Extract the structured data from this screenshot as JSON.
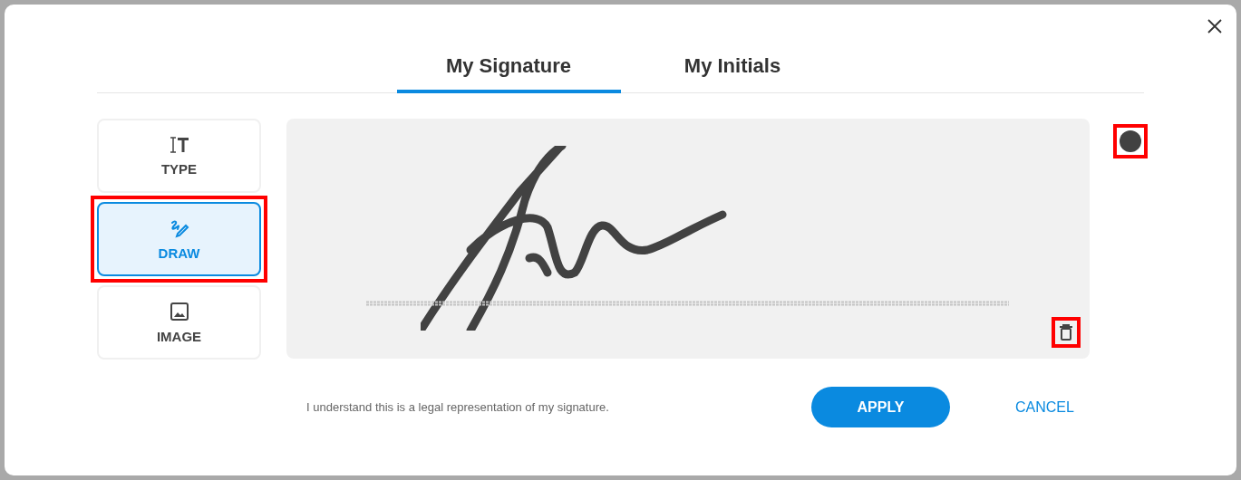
{
  "tabs": [
    {
      "label": "My Signature",
      "selected": true
    },
    {
      "label": "My Initials",
      "selected": false
    }
  ],
  "modes": [
    {
      "kind": "type",
      "label": "TYPE",
      "selected": false,
      "highlighted": false
    },
    {
      "kind": "draw",
      "label": "DRAW",
      "selected": true,
      "highlighted": true
    },
    {
      "kind": "image",
      "label": "IMAGE",
      "selected": false,
      "highlighted": false
    }
  ],
  "pad": {
    "color": "#424242",
    "color_highlighted": true,
    "clear_highlighted": true
  },
  "consent": "I understand this is a legal representation of my signature.",
  "buttons": [
    {
      "kind": "primary",
      "label": "APPLY"
    },
    {
      "kind": "link",
      "label": "CANCEL"
    }
  ]
}
